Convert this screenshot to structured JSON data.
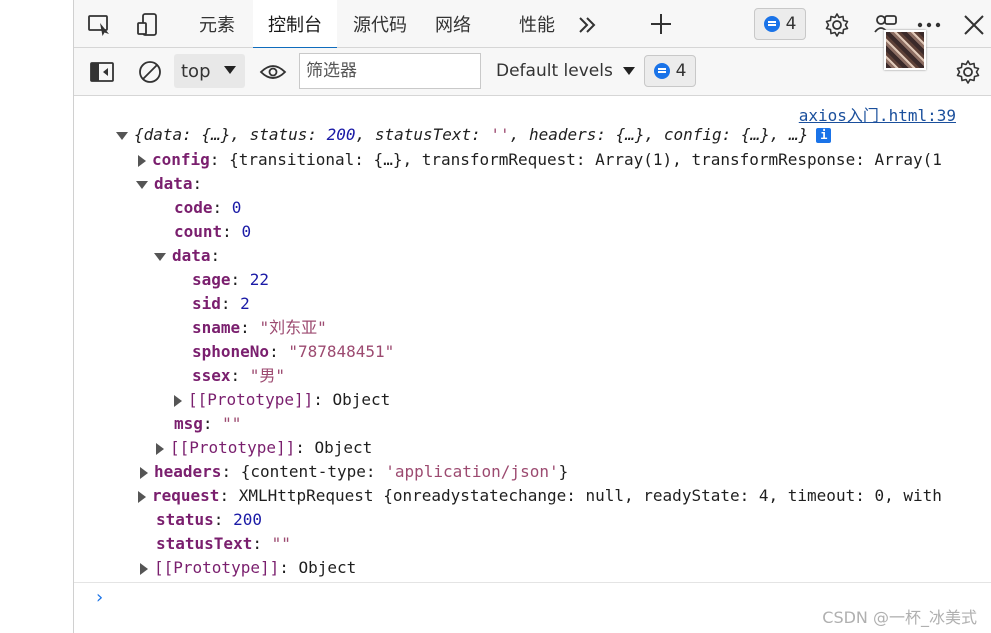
{
  "tabs": [
    {
      "label": "元素"
    },
    {
      "label": "控制台"
    },
    {
      "label": "源代码"
    },
    {
      "label": "网络"
    },
    {
      "label": "性能"
    }
  ],
  "issues": {
    "top_count": "4",
    "toolbar_count": "4"
  },
  "toolbar": {
    "context": "top",
    "filter_placeholder": "筛选器",
    "levels": "Default levels"
  },
  "console": {
    "source_link": "axios入门.html:39",
    "summary": {
      "text1": "{data: {…}, status: ",
      "status": "200",
      "text2": ", statusText: ",
      "statusText": "''",
      "text3": ", headers: {…}, config: {…}, …}",
      "info": "i"
    },
    "config": {
      "key": "config",
      "sep": ": ",
      "value": "{transitional: {…}, transformRequest: Array(1), transformResponse: Array(1"
    },
    "data": {
      "key": "data",
      "sep": ":"
    },
    "code": {
      "key": "code",
      "sep": ": ",
      "value": "0"
    },
    "count": {
      "key": "count",
      "sep": ": ",
      "value": "0"
    },
    "data_inner": {
      "key": "data",
      "sep": ":"
    },
    "sage": {
      "key": "sage",
      "sep": ": ",
      "value": "22"
    },
    "sid": {
      "key": "sid",
      "sep": ": ",
      "value": "2"
    },
    "sname": {
      "key": "sname",
      "sep": ": ",
      "value": "\"刘东亚\""
    },
    "sphoneNo": {
      "key": "sphoneNo",
      "sep": ": ",
      "value": "\"787848451\""
    },
    "ssex": {
      "key": "ssex",
      "sep": ": ",
      "value": "\"男\""
    },
    "proto_inner": {
      "key": "[[Prototype]]",
      "sep": ": ",
      "value": "Object"
    },
    "msg": {
      "key": "msg",
      "sep": ": ",
      "value": "\"\""
    },
    "proto_data": {
      "key": "[[Prototype]]",
      "sep": ": ",
      "value": "Object"
    },
    "headers": {
      "key": "headers",
      "sep": ": ",
      "value_pre": "{content-type: ",
      "value_str": "'application/json'",
      "value_post": "}"
    },
    "request": {
      "key": "request",
      "sep": ": ",
      "value": "XMLHttpRequest {onreadystatechange: null, readyState: 4, timeout: 0, with"
    },
    "status": {
      "key": "status",
      "sep": ": ",
      "value": "200"
    },
    "statusText": {
      "key": "statusText",
      "sep": ": ",
      "value": "\"\""
    },
    "proto_root": {
      "key": "[[Prototype]]",
      "sep": ": ",
      "value": "Object"
    },
    "prompt": "›"
  },
  "watermark": "CSDN @一杯_冰美式",
  "colors": {
    "accent": "#0f6cbd",
    "badge": "#1a73e8",
    "key": "#7a1f6e",
    "number": "#1a1aa6",
    "string": "#9c4a70"
  }
}
